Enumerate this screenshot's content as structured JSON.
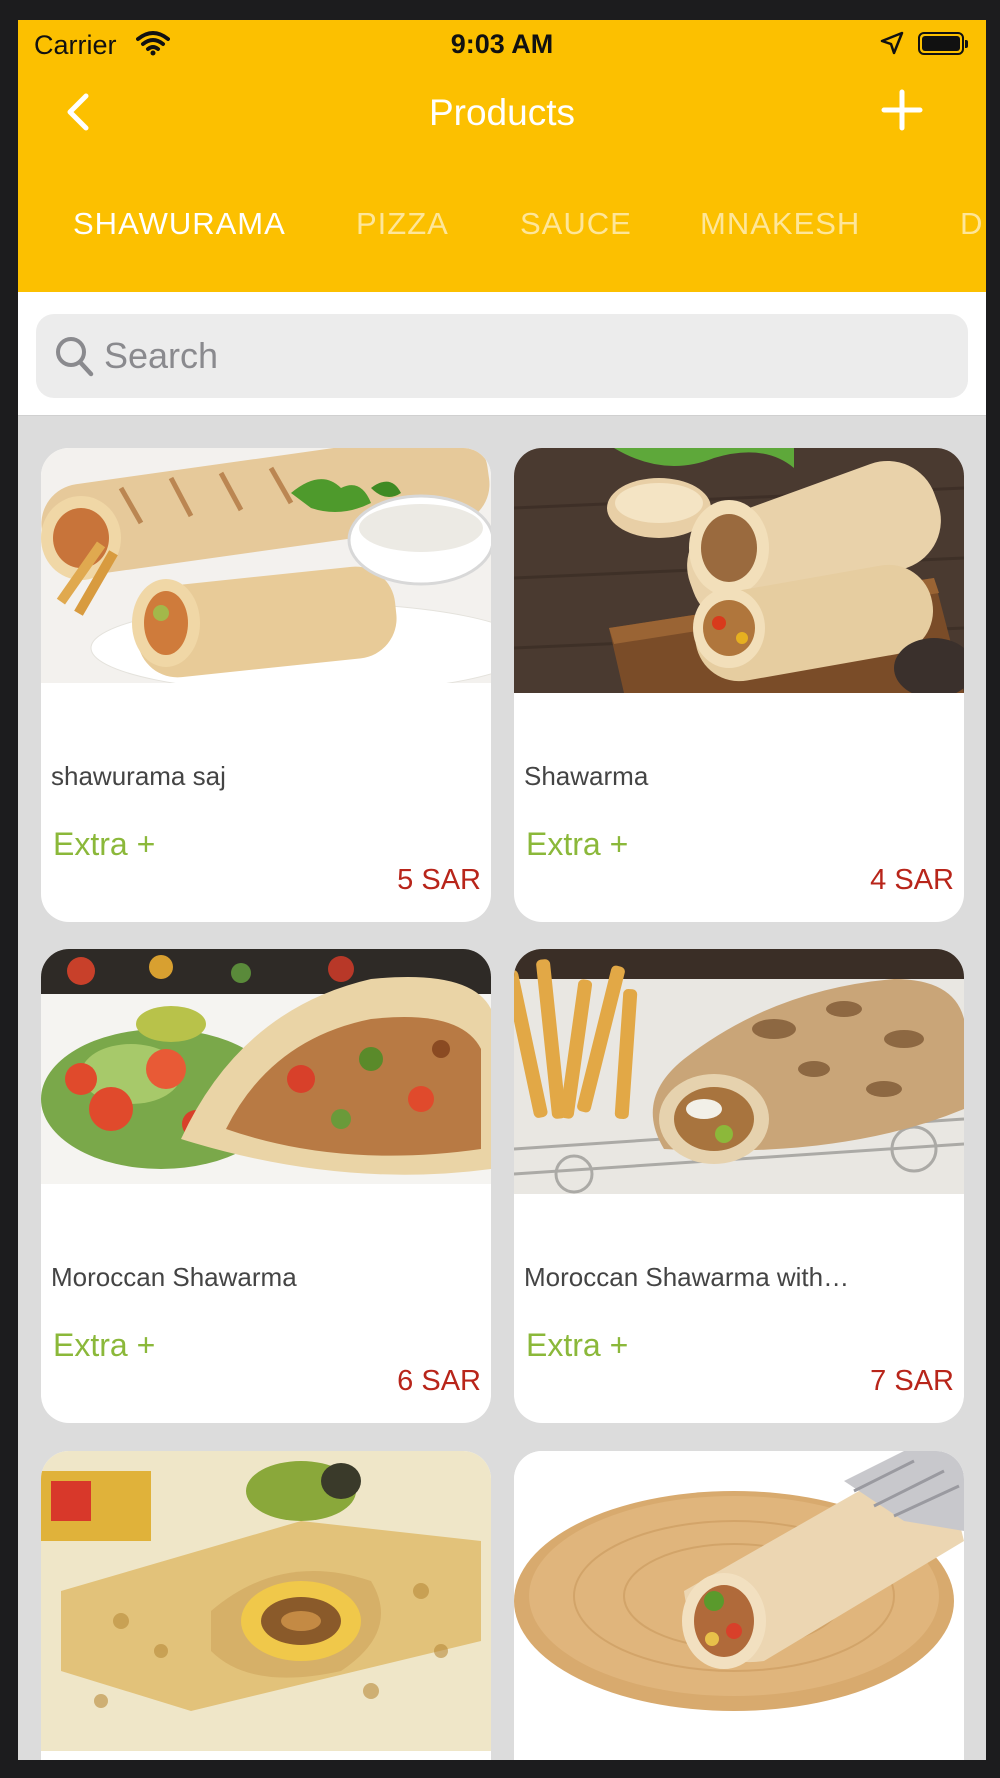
{
  "status_bar": {
    "carrier": "Carrier",
    "time": "9:03 AM"
  },
  "navbar": {
    "title": "Products",
    "back_icon": "chevron-left-icon",
    "add_icon": "plus-icon"
  },
  "tabs": [
    {
      "label": "SHAWURAMA",
      "active": true
    },
    {
      "label": "PIZZA",
      "active": false
    },
    {
      "label": "SAUCE",
      "active": false
    },
    {
      "label": "MNAKESH",
      "active": false
    },
    {
      "label": "D",
      "active": false
    }
  ],
  "search": {
    "placeholder": "Search",
    "value": ""
  },
  "products": [
    {
      "name": "shawurama saj",
      "extra_label": "Extra +",
      "price": "5 SAR"
    },
    {
      "name": "Shawarma",
      "extra_label": "Extra +",
      "price": "4 SAR"
    },
    {
      "name": "Moroccan Shawarma",
      "extra_label": "Extra +",
      "price": "6 SAR"
    },
    {
      "name": "Moroccan Shawarma with…",
      "extra_label": "Extra +",
      "price": "7 SAR"
    },
    {
      "name": "",
      "extra_label": "",
      "price": ""
    },
    {
      "name": "",
      "extra_label": "",
      "price": ""
    }
  ],
  "colors": {
    "header": "#fcc000",
    "extra": "#8bb83a",
    "price": "#b8251a",
    "background": "#dcdcdc"
  }
}
